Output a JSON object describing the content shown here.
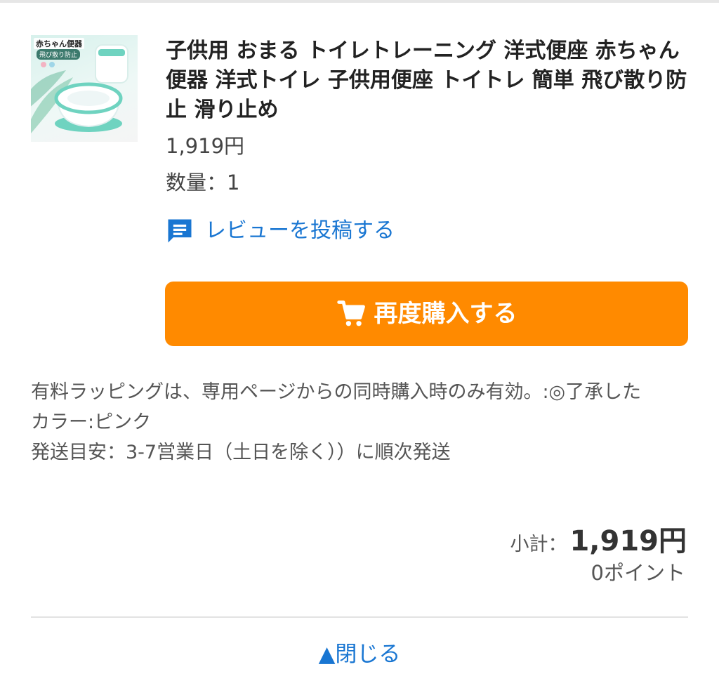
{
  "product": {
    "image_badge": "赤ちゃん便器",
    "image_badge_sub": "飛び散り防止",
    "title": "子供用 おまる トイレトレーニング 洋式便座 赤ちゃん便器 洋式トイレ 子供用便座 トイトレ 簡単 飛び散り防止 滑り止め",
    "price": "1,919円",
    "quantity": "数量：1"
  },
  "review": {
    "icon": "comment-icon",
    "label": "レビューを投稿する"
  },
  "rebuy": {
    "icon": "cart-icon",
    "label": "再度購入する"
  },
  "options": [
    "有料ラッピングは、専用ページからの同時購入時のみ有効。:◎了承した",
    "カラー:ピンク",
    "発送目安：3-7営業日（土日を除く））に順次発送"
  ],
  "summary": {
    "subtotal_label": "小計：",
    "subtotal_value": "1,919円",
    "points": "0ポイント"
  },
  "close": {
    "label": "▲閉じる"
  },
  "colors": {
    "accent_blue": "#1976d2",
    "button_orange": "#ff8a00",
    "product_teal": "#6fd3c0"
  }
}
